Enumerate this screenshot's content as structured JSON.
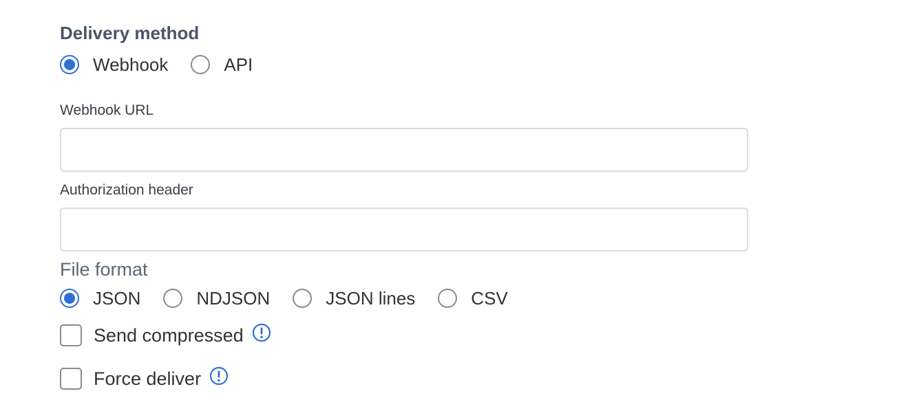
{
  "delivery": {
    "title": "Delivery method",
    "options": [
      {
        "label": "Webhook",
        "selected": true
      },
      {
        "label": "API",
        "selected": false
      }
    ]
  },
  "fields": {
    "webhook_url": {
      "label": "Webhook URL",
      "value": "",
      "placeholder": ""
    },
    "authorization_header": {
      "label": "Authorization header",
      "value": "",
      "placeholder": ""
    }
  },
  "file_format": {
    "title": "File format",
    "options": [
      {
        "label": "JSON",
        "selected": true
      },
      {
        "label": "NDJSON",
        "selected": false
      },
      {
        "label": "JSON lines",
        "selected": false
      },
      {
        "label": "CSV",
        "selected": false
      }
    ]
  },
  "checkboxes": {
    "send_compressed": {
      "label": "Send compressed",
      "checked": false,
      "icon": "info-icon"
    },
    "force_deliver": {
      "label": "Force deliver",
      "checked": false,
      "icon": "info-icon"
    }
  },
  "colors": {
    "accent": "#2f6fd4",
    "heading": "#4a5568",
    "border": "#d9dce1"
  }
}
